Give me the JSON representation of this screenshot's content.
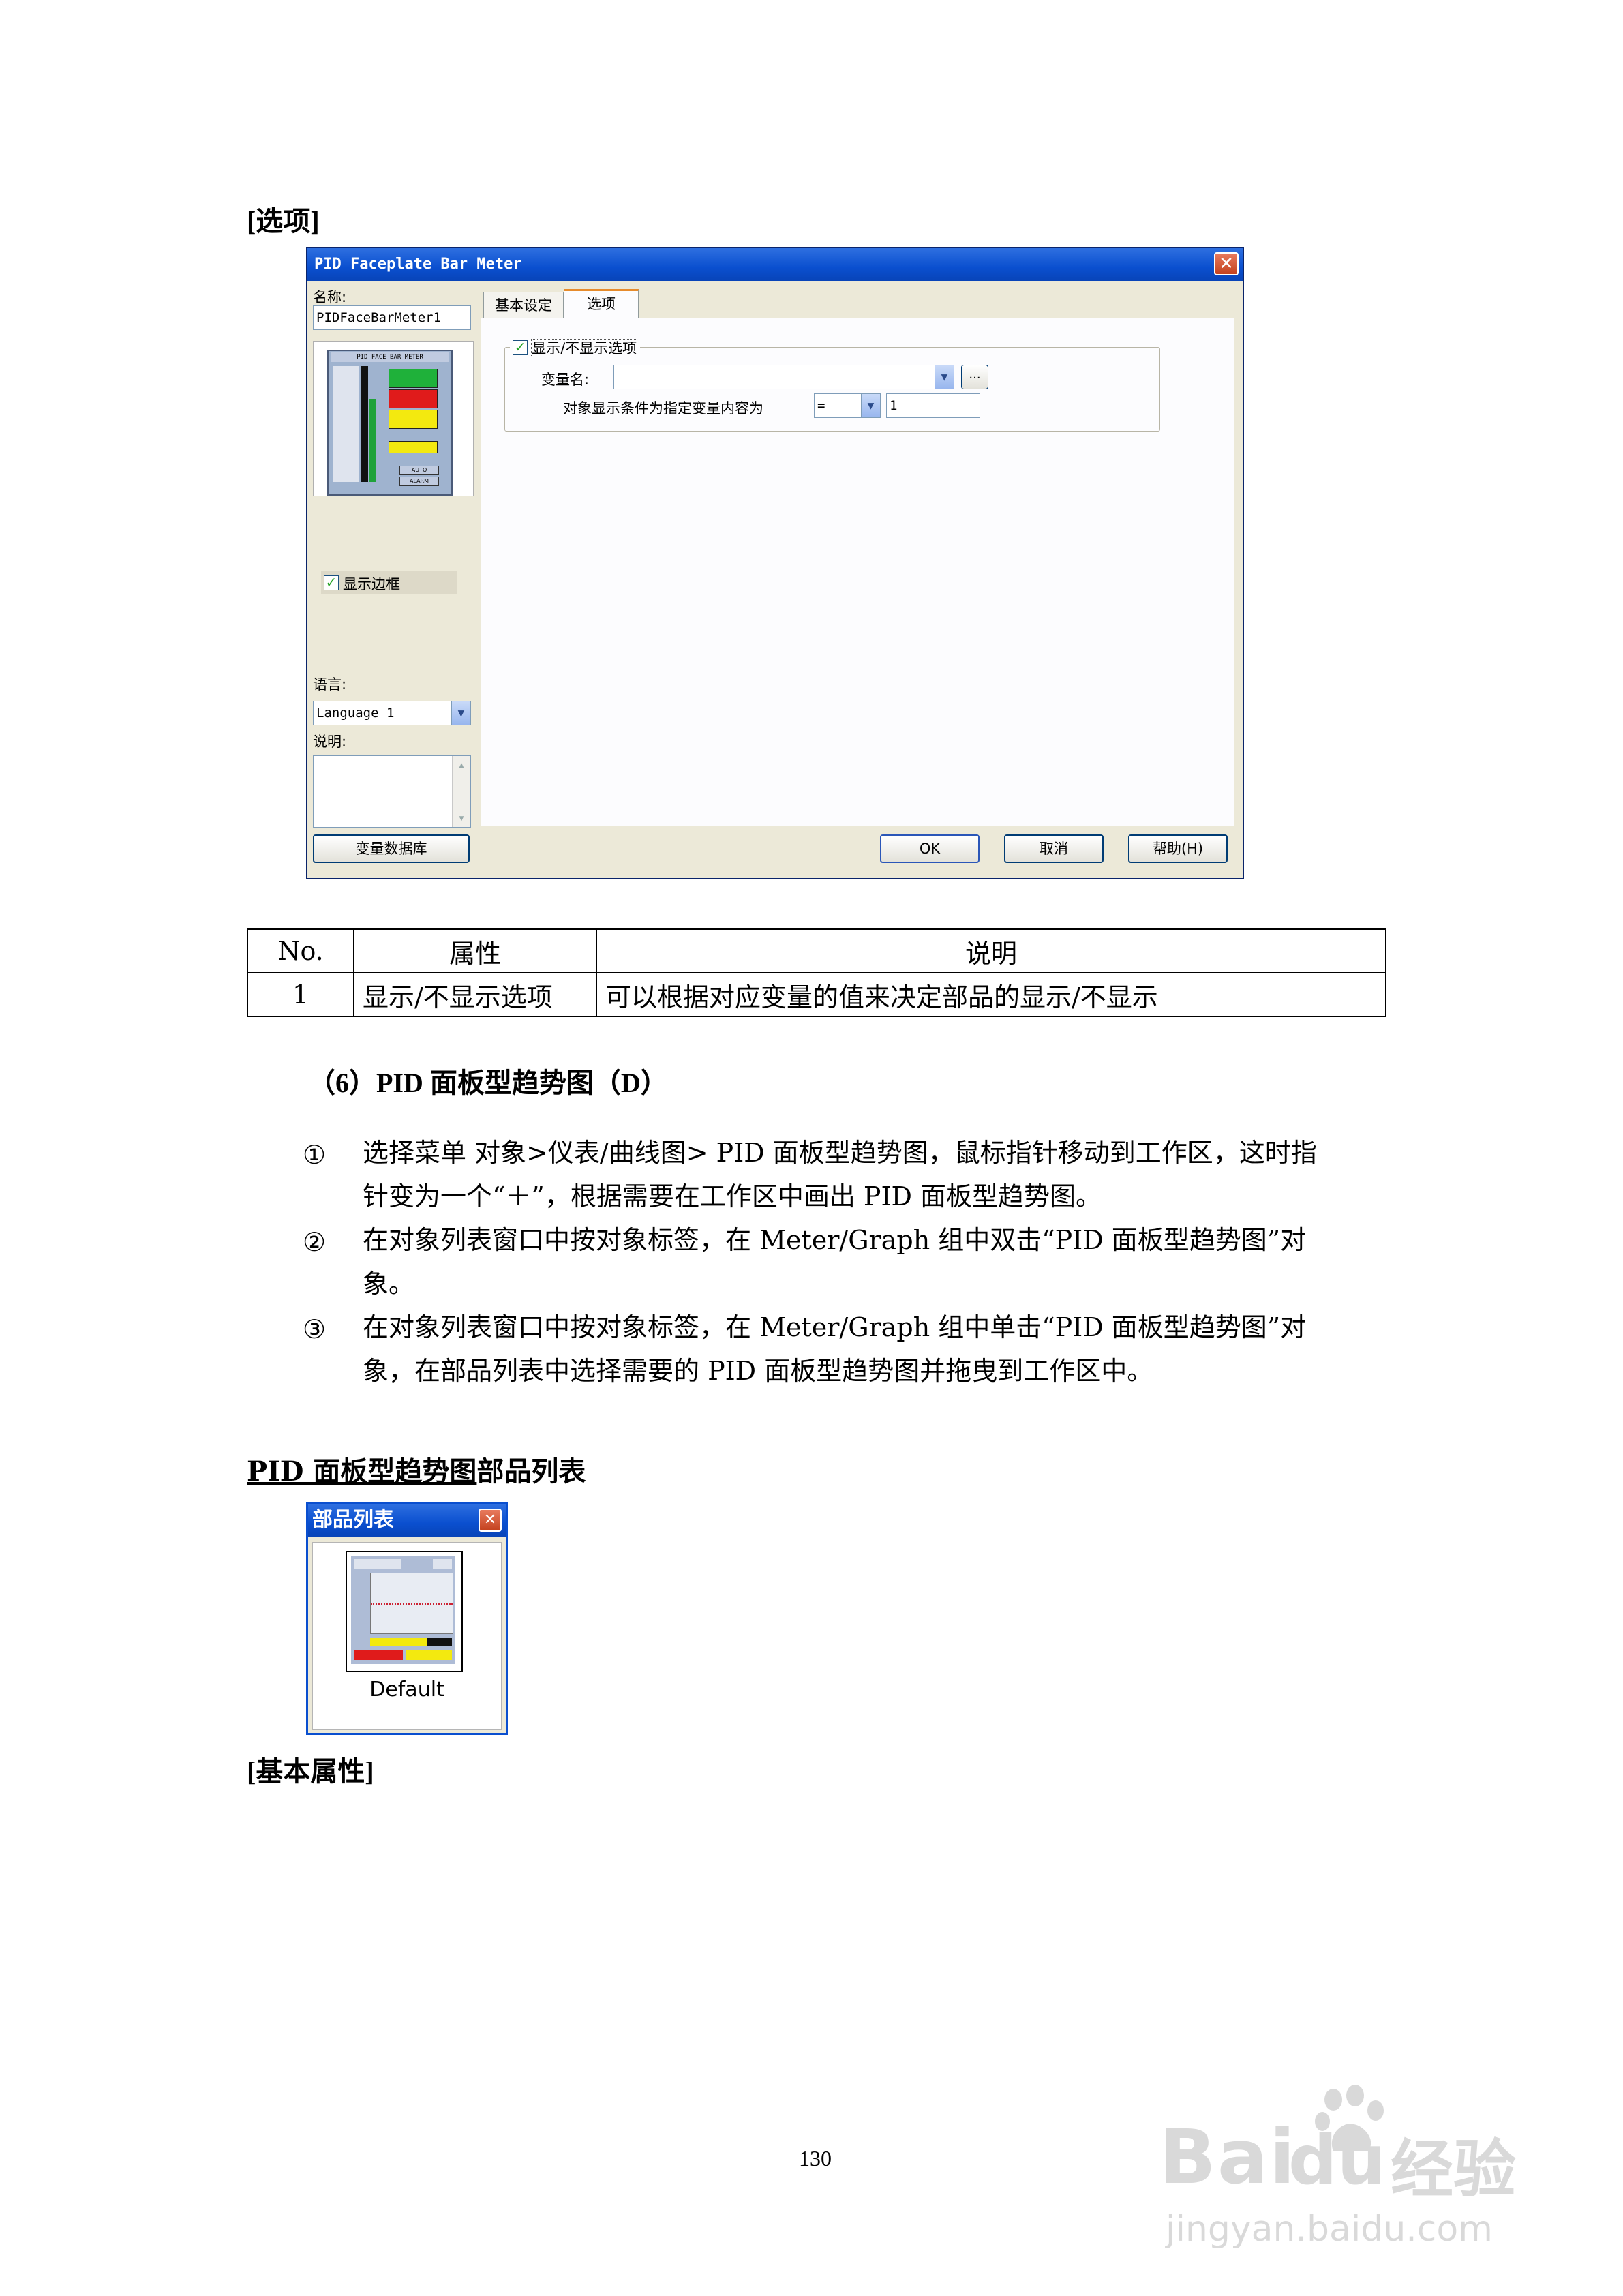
{
  "sections": {
    "options_heading": "[选项]",
    "basic_props_heading": "[基本属性]"
  },
  "dialog": {
    "title": "PID Faceplate Bar Meter",
    "close_glyph": "✕",
    "name_label": "名称:",
    "name_value": "PIDFaceBarMeter1",
    "show_border_label": "显示边框",
    "language_label": "语言:",
    "language_value": "Language 1",
    "description_label": "说明:",
    "tabs": [
      "基本设定",
      "选项"
    ],
    "show_hide_option_label": "显示/不显示选项",
    "variable_name_label": "变量名:",
    "variable_name_value": "",
    "browse_label": "...",
    "condition_label": "对象显示条件为指定变量内容为",
    "operator_value": "=",
    "condition_value": "1",
    "buttons": {
      "variable_db": "变量数据库",
      "ok": "OK",
      "cancel": "取消",
      "help": "帮助(H)"
    },
    "preview": {
      "title": "PID FACE BAR METER",
      "auto": "AUTO",
      "alarm": "ALARM"
    }
  },
  "table": {
    "headers": [
      "No.",
      "属性",
      "说明"
    ],
    "rows": [
      [
        "1",
        "显示/不显示选项",
        "可以根据对应变量的值来决定部品的显示/不显示"
      ]
    ]
  },
  "section6": {
    "title": "（6）PID 面板型趋势图（D）",
    "steps": [
      {
        "marker": "①",
        "line1": "选择菜单  对象>仪表/曲线图> PID 面板型趋势图，鼠标指针移动到工作区，这时指",
        "line2": "针变为一个“＋”，根据需要在工作区中画出 PID 面板型趋势图。"
      },
      {
        "marker": "②",
        "line1": "在对象列表窗口中按对象标签，在 Meter/Graph 组中双击“PID 面板型趋势图”对",
        "line2": "象。"
      },
      {
        "marker": "③",
        "line1": "在对象列表窗口中按对象标签，在 Meter/Graph 组中单击“PID 面板型趋势图”对",
        "line2": "象，在部品列表中选择需要的 PID 面板型趋势图并拖曳到工作区中。"
      }
    ]
  },
  "parts_list": {
    "heading_underlined": "PID 面板型趋势图",
    "heading_rest": "部品列表",
    "window_title": "部品列表",
    "close_glyph": "✕",
    "item_label": "Default"
  },
  "page_number": "130",
  "watermark": {
    "brand": "Bai",
    "brand2": "du",
    "cn": "经验",
    "url": "jingyan.baidu.com"
  }
}
